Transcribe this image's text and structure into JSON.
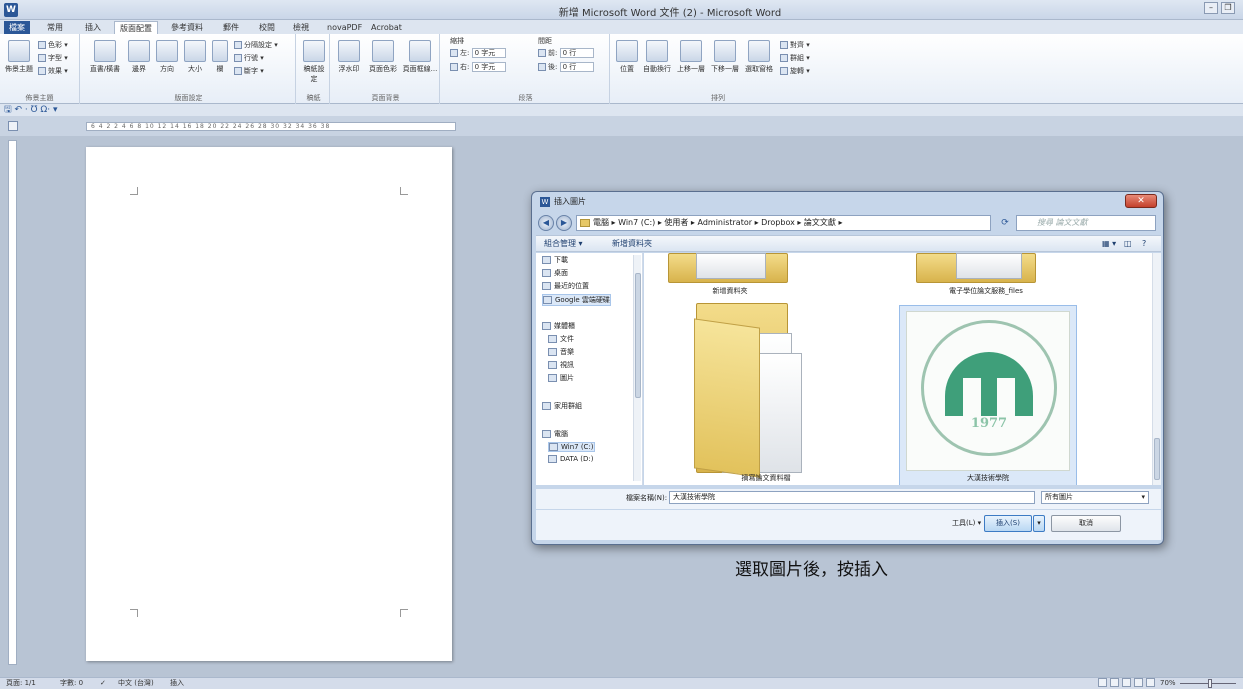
{
  "window": {
    "title": "新增 Microsoft Word 文件 (2) - Microsoft Word",
    "app_icon_letter": "W"
  },
  "ribbon": {
    "tabs": [
      "檔案",
      "常用",
      "插入",
      "版面配置",
      "參考資料",
      "郵件",
      "校閱",
      "檢視",
      "novaPDF",
      "Acrobat"
    ],
    "active_tab": "版面配置",
    "themes": {
      "group_name": "佈景主題",
      "themes_label": "佈景主題",
      "colors_label": "色彩 ▾",
      "fonts_label": "字型 ▾",
      "effects_label": "效果 ▾"
    },
    "page_setup": {
      "group_name": "版面設定",
      "text_direction": "直書/橫書",
      "margins": "邊界",
      "orientation": "方向",
      "size": "大小",
      "columns": "欄",
      "breaks": "分隔設定 ▾",
      "line_numbers": "行號 ▾",
      "hyphenation": "斷字 ▾"
    },
    "paper": {
      "group_name": "稿紙",
      "setup": "稿紙設定"
    },
    "page_background": {
      "group_name": "頁面背景",
      "watermark": "浮水印",
      "page_color": "頁面色彩",
      "page_borders": "頁面框線..."
    },
    "paragraph": {
      "group_name": "段落",
      "indent_label": "縮排",
      "spacing_label": "間距",
      "left_label": "左:",
      "left_value": "0 字元",
      "right_label": "右:",
      "right_value": "0 字元",
      "before_label": "前:",
      "before_value": "0 行",
      "after_label": "後:",
      "after_value": "0 行"
    },
    "arrange": {
      "group_name": "排列",
      "position": "位置",
      "wrap_text": "自動換行",
      "bring_forward": "上移一層",
      "send_backward": "下移一層",
      "selection_pane": "選取窗格",
      "align": "對齊 ▾",
      "group": "群組 ▾",
      "rotate": "旋轉 ▾"
    }
  },
  "qat": {
    "icons": "🖫 ↶ · Ʊ Ω· ▾"
  },
  "ruler": {
    "ticks": "6 4 2 2 4 6 8 10 12 14 16 18 20 22 24 26 28 30 32 34 36 38"
  },
  "dialog": {
    "title": "插入圖片",
    "close_label": "✕",
    "breadcrumb": "電腦 ▸ Win7 (C:) ▸ 使用者 ▸ Administrator ▸ Dropbox ▸ 論文文獻 ▸",
    "search_placeholder": "搜尋 論文文獻",
    "toolbar": {
      "organize": "組合管理 ▾",
      "new_folder": "新增資料夾"
    },
    "nav_items": [
      {
        "label": "下載",
        "icon": "download-folder-icon"
      },
      {
        "label": "桌面",
        "icon": "desktop-icon"
      },
      {
        "label": "最近的位置",
        "icon": "recent-places-icon"
      },
      {
        "label": "Google 雲端硬碟",
        "icon": "google-drive-icon"
      },
      {
        "label": "媒體櫃",
        "icon": "libraries-icon"
      },
      {
        "label": "文件",
        "icon": "documents-icon"
      },
      {
        "label": "音樂",
        "icon": "music-icon"
      },
      {
        "label": "視訊",
        "icon": "video-icon"
      },
      {
        "label": "圖片",
        "icon": "pictures-icon"
      },
      {
        "label": "家用群組",
        "icon": "homegroup-icon"
      },
      {
        "label": "電腦",
        "icon": "computer-icon"
      },
      {
        "label": "Win7 (C:)",
        "icon": "drive-icon"
      },
      {
        "label": "DATA (D:)",
        "icon": "drive-icon"
      }
    ],
    "files": [
      {
        "label": "新增資料夾"
      },
      {
        "label": "電子學位論文服務_files"
      },
      {
        "label": "摘寫論文資料檔"
      },
      {
        "label": "大漢技術學院"
      }
    ],
    "logo_year": "1977",
    "filename_label": "檔案名稱(N):",
    "filename_value": "大漢技術學院",
    "filetype_value": "所有圖片",
    "tools_label": "工具(L)  ▾",
    "insert_label": "插入(S)",
    "insert_dropdown": "▾",
    "cancel_label": "取消"
  },
  "caption": "選取圖片後，按插入",
  "statusbar": {
    "page": "頁面: 1/1",
    "words": "字數: 0",
    "language": "中文 (台灣)",
    "mode": "插入",
    "zoom": "70%"
  }
}
